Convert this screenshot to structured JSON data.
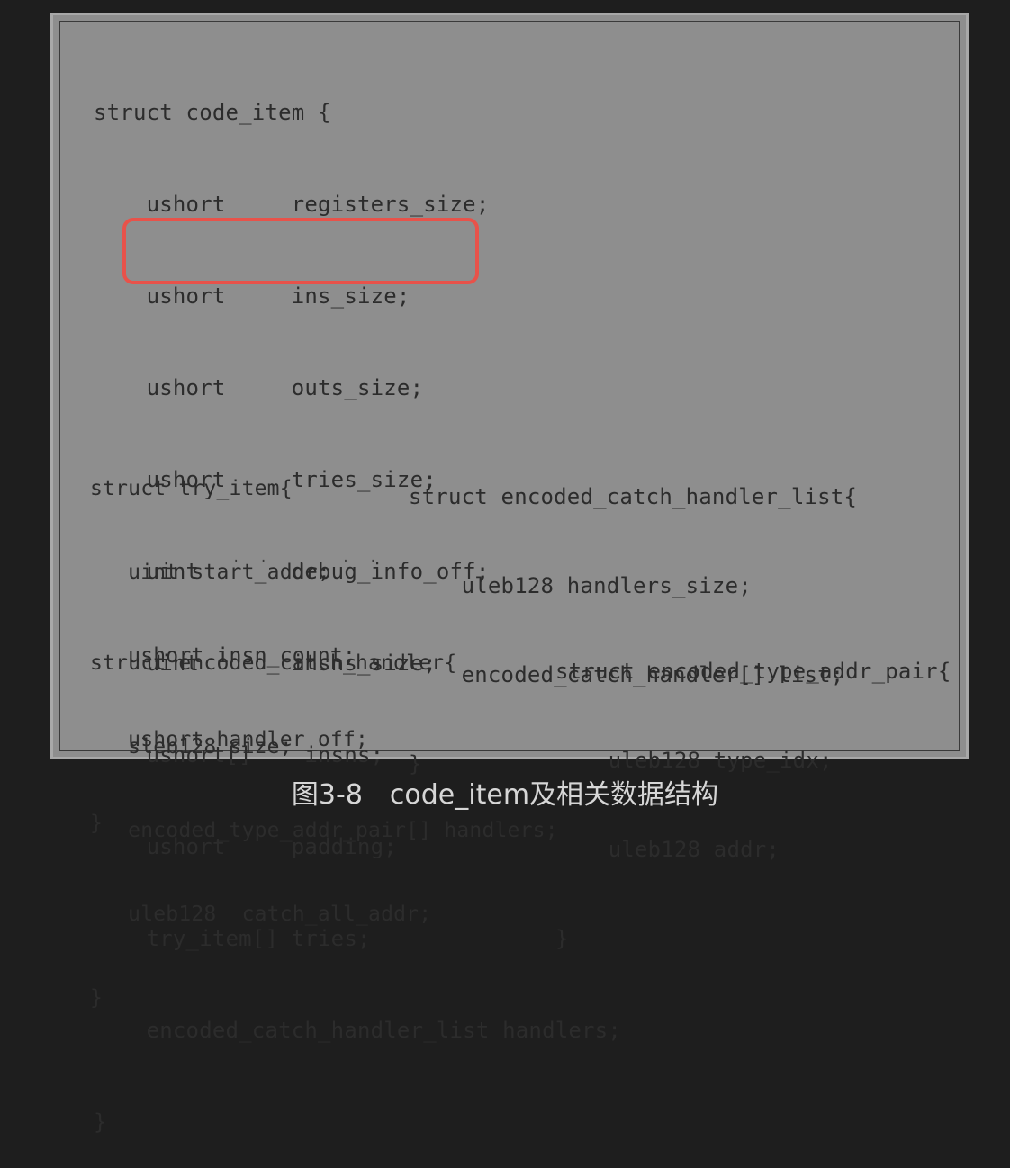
{
  "code_item": {
    "lines": [
      "struct code_item {",
      "    ushort     registers_size;",
      "    ushort     ins_size;",
      "    ushort     outs_size;",
      "    ushort     tries_size;",
      "    uint       debug_info_off;",
      "    uint       insns_size;",
      "    ushort[]    insns;",
      "    ushort     padding;",
      "    try_item[] tries;",
      "    encoded_catch_handler_list handlers;",
      "}"
    ],
    "highlighted_fields": [
      "insns_size",
      "insns"
    ]
  },
  "try_item": {
    "lines": [
      "struct try_item{",
      "   uint start_addr;",
      "   ushort insn_count;",
      "   ushort handler_off;",
      "}"
    ]
  },
  "encoded_catch_handler_list": {
    "lines": [
      "struct encoded_catch_handler_list{",
      "    uleb128 handlers_size;",
      "    encoded_catch_handler[] list;",
      "}"
    ]
  },
  "encoded_catch_handler": {
    "lines": [
      "struct encoded_catch_handler{",
      "   sleb128 size;",
      "   encoded_type_addr_pair[] handlers;",
      "   uleb128  catch_all_addr;",
      "}"
    ]
  },
  "encoded_type_addr_pair": {
    "lines": [
      "struct encoded_type_addr_pair{",
      "    uleb128 type_idx;",
      "    uleb128 addr;",
      "}"
    ]
  },
  "caption": "图3-8　code_item及相关数据结构",
  "colors": {
    "background": "#1e1e1e",
    "figure": "#8e8e8e",
    "highlight": "#e8524a",
    "caption": "#d6d6d6"
  }
}
